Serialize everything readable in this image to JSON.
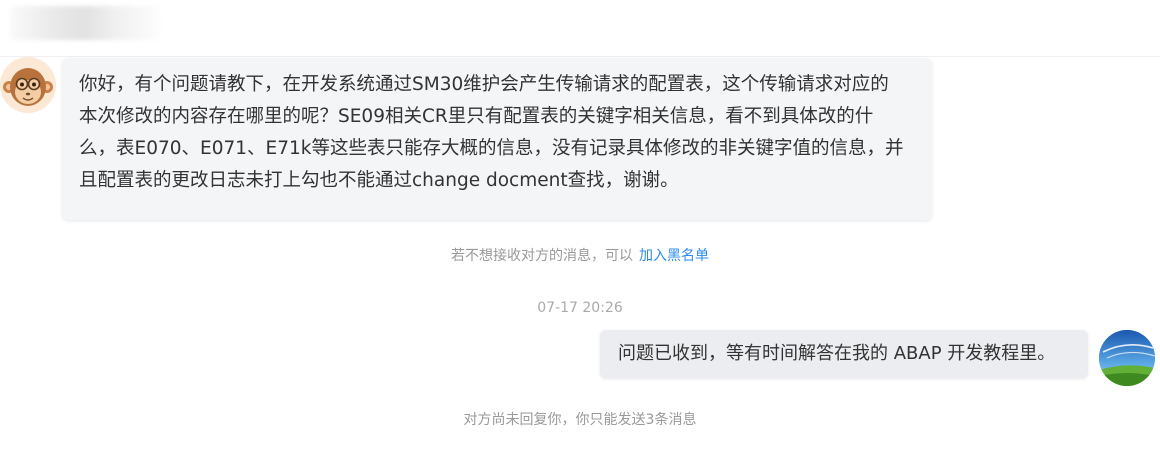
{
  "header": {
    "contact_name": ""
  },
  "messages": {
    "incoming": {
      "text": "你好，有个问题请教下，在开发系统通过SM30维护会产生传输请求的配置表，这个传输请求对应的\n本次修改的内容存在哪里的呢？SE09相关CR里只有配置表的关键字相关信息，看不到具体改的什\n么，表E070、E071、E71k等这些表只能存大概的信息，没有记录具体修改的非关键字值的信息，并\n且配置表的更改日志未打上勾也不能通过change docment查找，谢谢。",
      "avatar_icon": "monkey-avatar-icon"
    },
    "block_notice": {
      "text": "若不想接收对方的消息，可以",
      "link_label": "加入黑名单"
    },
    "timestamp": "07-17 20:26",
    "outgoing": {
      "text": "问题已收到，等有时间解答在我的 ABAP 开发教程里。",
      "avatar_icon": "landscape-avatar-icon"
    },
    "limit_notice": "对方尚未回复你，你只能发送3条消息"
  },
  "colors": {
    "bubble_in": "#f4f5f7",
    "bubble_out": "#ebedf0",
    "link": "#2d8cf0",
    "system_text": "#999999"
  }
}
